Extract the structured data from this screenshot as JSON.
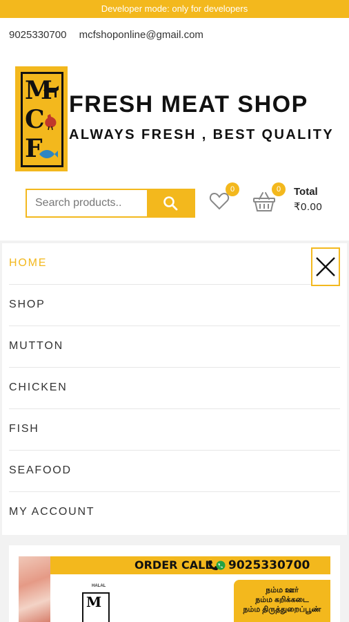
{
  "dev_banner": "Developer mode: only for developers",
  "contact": {
    "phone": "9025330700",
    "email": "mcfshoponline@gmail.com"
  },
  "logo": {
    "letters": [
      "M",
      "C",
      "F"
    ],
    "brand_color": "#f3b81d"
  },
  "brand": {
    "title": "FRESH MEAT SHOP",
    "subtitle": "ALWAYS FRESH , BEST QUALITY"
  },
  "search": {
    "placeholder": "Search products..",
    "value": "",
    "button_icon": "search-icon"
  },
  "wishlist": {
    "icon": "heart-icon",
    "count": "0"
  },
  "cart": {
    "icon": "basket-icon",
    "count": "0",
    "total_label": "Total",
    "total_value": "₹0.00"
  },
  "menu": {
    "items": [
      {
        "label": "HOME",
        "active": true
      },
      {
        "label": "SHOP",
        "active": false
      },
      {
        "label": "MUTTON",
        "active": false
      },
      {
        "label": "CHICKEN",
        "active": false
      },
      {
        "label": "FISH",
        "active": false
      },
      {
        "label": "SEAFOOD",
        "active": false
      },
      {
        "label": "MY ACCOUNT",
        "active": false
      }
    ],
    "close_icon": "close-icon"
  },
  "banner": {
    "order_text": "ORDER CALL",
    "phone": "9025330700",
    "halal": "HALAL",
    "tamil_lines": [
      "நம்ம ஊர்",
      "நம்ம கறிக்கடை",
      "நம்ம திருத்துறைப்பூண்"
    ]
  },
  "colors": {
    "accent": "#f3b81d",
    "text": "#333333"
  }
}
